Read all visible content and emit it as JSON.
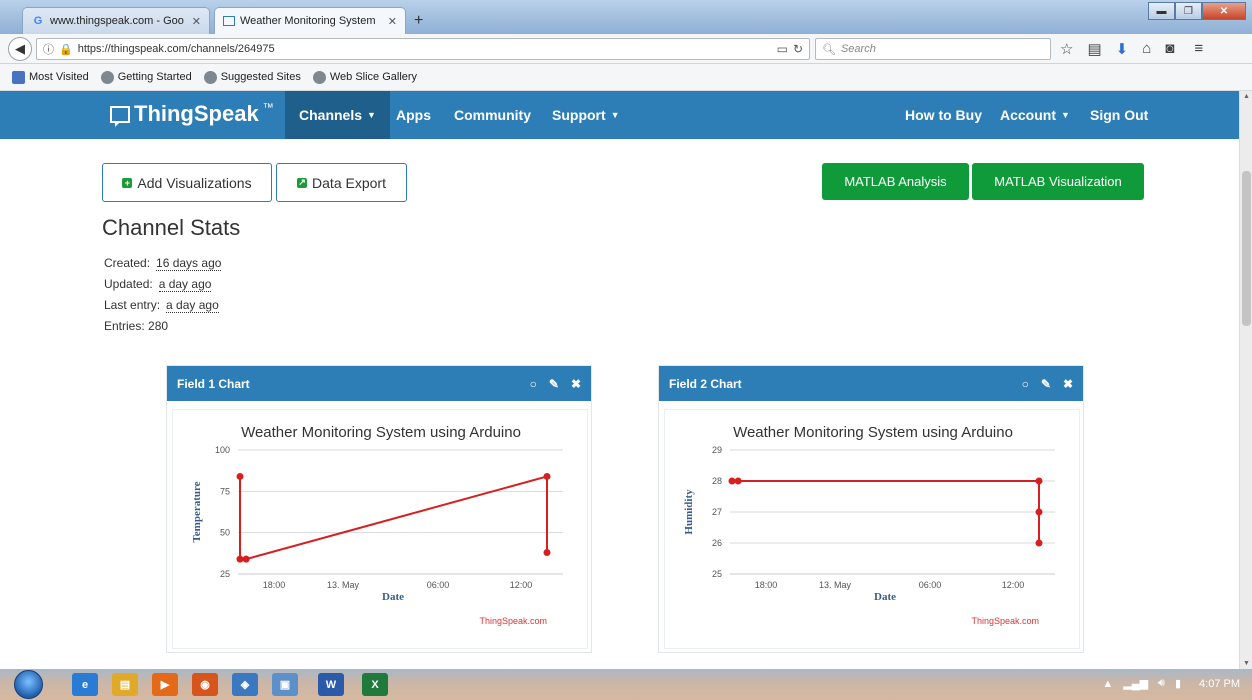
{
  "browser": {
    "tabs": [
      {
        "title": "www.thingspeak.com - Goo",
        "close": "✕"
      },
      {
        "title": "Weather Monitoring System",
        "close": "✕"
      }
    ],
    "new_tab": "+",
    "window_buttons": {
      "minimize": "▬",
      "maximize": "❐",
      "close": "✕"
    },
    "url": "https://thingspeak.com/channels/264975",
    "search_placeholder": "Search",
    "bookmarks": [
      "Most Visited",
      "Getting Started",
      "Suggested Sites",
      "Web Slice Gallery"
    ]
  },
  "site": {
    "logo": "ThingSpeak",
    "logo_tm": "™",
    "nav_left": [
      "Channels",
      "Apps",
      "Community",
      "Support"
    ],
    "nav_right": [
      "How to Buy",
      "Account",
      "Sign Out"
    ]
  },
  "actions": {
    "add_visualizations": "Add Visualizations",
    "data_export": "Data Export",
    "matlab_analysis": "MATLAB Analysis",
    "matlab_visualization": "MATLAB Visualization"
  },
  "channel_stats": {
    "title": "Channel Stats",
    "created_label": "Created:",
    "created_value": "16 days ago",
    "updated_label": "Updated:",
    "updated_value": "a day ago",
    "last_entry_label": "Last entry:",
    "last_entry_value": "a day ago",
    "entries_label": "Entries:",
    "entries_value": "280"
  },
  "cards": [
    {
      "header": "Field 1 Chart",
      "credit": "ThingSpeak.com"
    },
    {
      "header": "Field 2 Chart",
      "credit": "ThingSpeak.com"
    }
  ],
  "chart_data": [
    {
      "type": "line",
      "title": "Weather Monitoring System using Arduino",
      "xlabel": "Date",
      "ylabel": "Temperature",
      "x_ticks": [
        "18:00",
        "13. May",
        "06:00",
        "12:00"
      ],
      "y_ticks": [
        25,
        50,
        75,
        100
      ],
      "ylim": [
        25,
        100
      ],
      "color": "#d62020",
      "points": [
        {
          "x": 0.0,
          "y": 84
        },
        {
          "x": 0.0,
          "y": 34
        },
        {
          "x": 0.02,
          "y": 34
        },
        {
          "x": 1.0,
          "y": 84
        },
        {
          "x": 1.0,
          "y": 38
        }
      ]
    },
    {
      "type": "line",
      "title": "Weather Monitoring System using Arduino",
      "xlabel": "Date",
      "ylabel": "Humidity",
      "x_ticks": [
        "18:00",
        "13. May",
        "06:00",
        "12:00"
      ],
      "y_ticks": [
        25,
        26,
        27,
        28,
        29
      ],
      "ylim": [
        25,
        29
      ],
      "color": "#d62020",
      "points": [
        {
          "x": 0.0,
          "y": 28
        },
        {
          "x": 0.02,
          "y": 28
        },
        {
          "x": 1.0,
          "y": 28
        },
        {
          "x": 1.0,
          "y": 27
        },
        {
          "x": 1.0,
          "y": 26
        }
      ]
    }
  ],
  "taskbar": {
    "time": "4:07 PM"
  }
}
